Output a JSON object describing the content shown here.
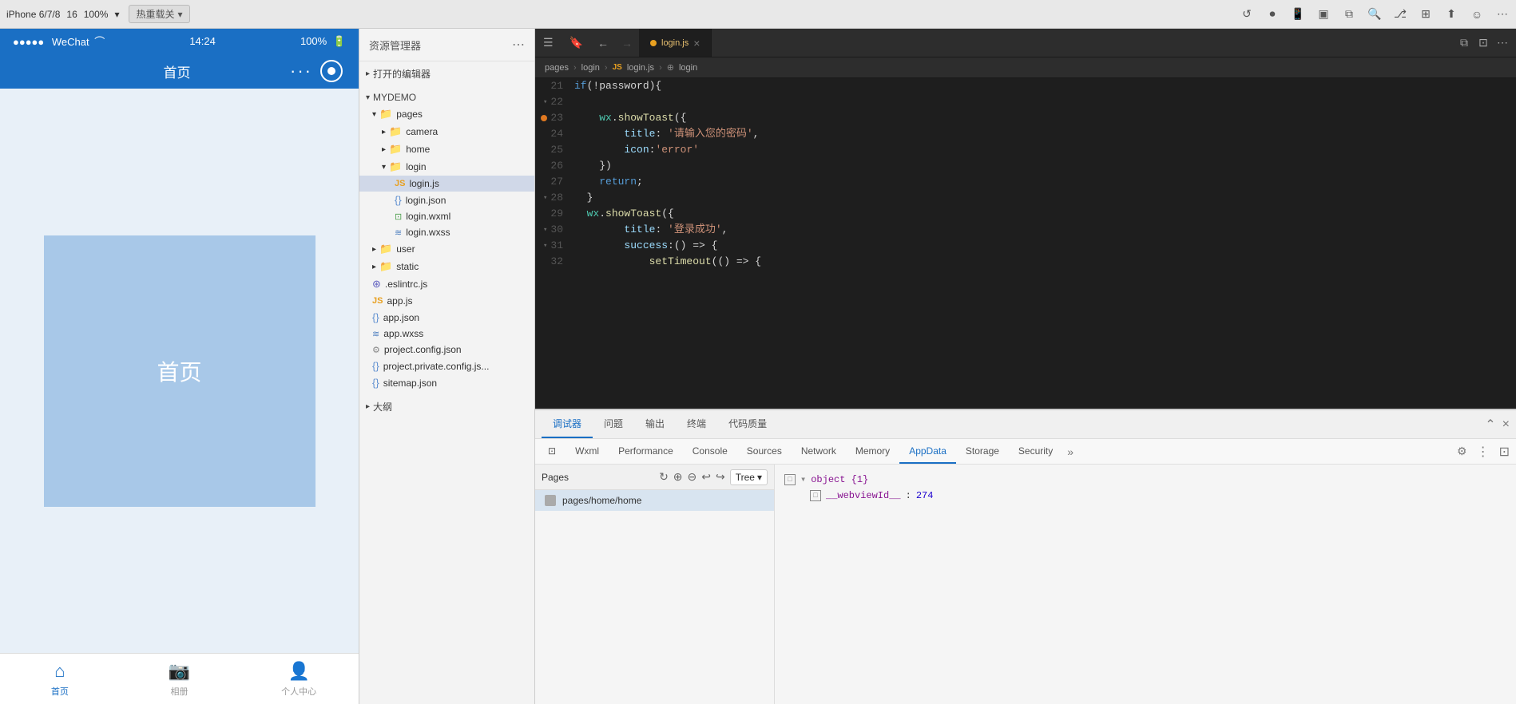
{
  "topToolbar": {
    "deviceLabel": "iPhone 6/7/8",
    "zoomLabel": "100%",
    "deviceNum": "16",
    "chevronIcon": "▾",
    "hotReloadLabel": "热重载关",
    "chevronIcon2": "▾"
  },
  "phone": {
    "statusBar": {
      "signals": "●●●●●",
      "appName": "WeChat",
      "wifiIcon": "WiFi",
      "time": "14:24",
      "battery": "100%"
    },
    "navTitle": "首页",
    "contentLabel": "首页",
    "tabs": [
      {
        "id": "home",
        "label": "首页",
        "icon": "⌂",
        "active": true
      },
      {
        "id": "camera",
        "label": "相册",
        "icon": "📷",
        "active": false
      },
      {
        "id": "profile",
        "label": "个人中心",
        "icon": "👤",
        "active": false
      }
    ]
  },
  "filePanel": {
    "title": "资源管理器",
    "sections": {
      "openEditors": "打开的编辑器",
      "myDemo": "MYDEMO"
    },
    "tree": [
      {
        "id": "pages",
        "type": "folder",
        "name": "pages",
        "indent": 1,
        "open": true
      },
      {
        "id": "camera",
        "type": "folder",
        "name": "camera",
        "indent": 2,
        "open": false
      },
      {
        "id": "home",
        "type": "folder",
        "name": "home",
        "indent": 2,
        "open": false
      },
      {
        "id": "login",
        "type": "folder",
        "name": "login",
        "indent": 2,
        "open": true
      },
      {
        "id": "loginjs",
        "type": "js",
        "name": "login.js",
        "indent": 3,
        "selected": true
      },
      {
        "id": "loginjson",
        "type": "json",
        "name": "login.json",
        "indent": 3
      },
      {
        "id": "loginwxml",
        "type": "wxml",
        "name": "login.wxml",
        "indent": 3
      },
      {
        "id": "loginwxss",
        "type": "wxss",
        "name": "login.wxss",
        "indent": 3
      },
      {
        "id": "user",
        "type": "folder",
        "name": "user",
        "indent": 1,
        "open": false
      },
      {
        "id": "static",
        "type": "folder",
        "name": "static",
        "indent": 1,
        "open": false
      },
      {
        "id": "eslintrc",
        "type": "eslint",
        "name": ".eslintrc.js",
        "indent": 1
      },
      {
        "id": "appjs",
        "type": "js",
        "name": "app.js",
        "indent": 1
      },
      {
        "id": "appjson",
        "type": "json",
        "name": "app.json",
        "indent": 1
      },
      {
        "id": "appwxss",
        "type": "wxss",
        "name": "app.wxss",
        "indent": 1
      },
      {
        "id": "projectconfig",
        "type": "config",
        "name": "project.config.json",
        "indent": 1
      },
      {
        "id": "projectprivate",
        "type": "json",
        "name": "project.private.config.js...",
        "indent": 1
      },
      {
        "id": "sitemap",
        "type": "json",
        "name": "sitemap.json",
        "indent": 1
      }
    ],
    "outlineLabel": "大纲"
  },
  "editor": {
    "tab": {
      "icon": "JS",
      "filename": "login.js",
      "hasChanges": true
    },
    "breadcrumb": {
      "parts": [
        "pages",
        "login",
        "login.js",
        "login"
      ]
    },
    "lines": [
      {
        "num": 21,
        "hasFold": false,
        "hasError": false,
        "content": "if(!password){",
        "tokens": [
          {
            "t": "kw",
            "v": "if"
          },
          {
            "t": "punct",
            "v": "(!password){"
          }
        ]
      },
      {
        "num": 22,
        "hasFold": true,
        "hasError": false,
        "content": "",
        "tokens": []
      },
      {
        "num": 23,
        "hasFold": false,
        "hasError": true,
        "content": "    wx.showToast({",
        "tokens": [
          {
            "t": "plain",
            "v": "    "
          },
          {
            "t": "obj",
            "v": "wx"
          },
          {
            "t": "punct",
            "v": "."
          },
          {
            "t": "fn",
            "v": "showToast"
          },
          {
            "t": "punct",
            "v": "({"
          }
        ]
      },
      {
        "num": 24,
        "hasFold": false,
        "hasError": false,
        "content": "        title: '请输入您的密码',",
        "tokens": [
          {
            "t": "plain",
            "v": "        "
          },
          {
            "t": "prop",
            "v": "title"
          },
          {
            "t": "punct",
            "v": ": "
          },
          {
            "t": "str",
            "v": "'请输入您的密码'"
          },
          {
            "t": "punct",
            "v": ","
          }
        ]
      },
      {
        "num": 25,
        "hasFold": false,
        "hasError": false,
        "content": "        icon:'error'",
        "tokens": [
          {
            "t": "plain",
            "v": "        "
          },
          {
            "t": "prop",
            "v": "icon"
          },
          {
            "t": "punct",
            "v": ":"
          },
          {
            "t": "str",
            "v": "'error'"
          }
        ]
      },
      {
        "num": 26,
        "hasFold": false,
        "hasError": false,
        "content": "    })",
        "tokens": [
          {
            "t": "plain",
            "v": "    "
          },
          {
            "t": "punct",
            "v": "})"
          }
        ]
      },
      {
        "num": 27,
        "hasFold": false,
        "hasError": false,
        "content": "    return;",
        "tokens": [
          {
            "t": "plain",
            "v": "    "
          },
          {
            "t": "kw",
            "v": "return"
          },
          {
            "t": "punct",
            "v": ";"
          }
        ]
      },
      {
        "num": 28,
        "hasFold": true,
        "hasError": false,
        "content": "  }",
        "tokens": [
          {
            "t": "plain",
            "v": "  "
          },
          {
            "t": "punct",
            "v": "}"
          }
        ]
      },
      {
        "num": 29,
        "hasFold": false,
        "hasError": false,
        "content": "  wx.showToast({",
        "tokens": [
          {
            "t": "plain",
            "v": "  "
          },
          {
            "t": "obj",
            "v": "wx"
          },
          {
            "t": "punct",
            "v": "."
          },
          {
            "t": "fn",
            "v": "showToast"
          },
          {
            "t": "punct",
            "v": "({"
          }
        ]
      },
      {
        "num": 30,
        "hasFold": false,
        "hasError": false,
        "content": "        title: '登录成功',",
        "tokens": [
          {
            "t": "plain",
            "v": "        "
          },
          {
            "t": "prop",
            "v": "title"
          },
          {
            "t": "punct",
            "v": ": "
          },
          {
            "t": "str",
            "v": "'登录成功'"
          },
          {
            "t": "punct",
            "v": ","
          }
        ]
      },
      {
        "num": 31,
        "hasFold": true,
        "hasError": false,
        "content": "        success:() => {",
        "tokens": [
          {
            "t": "plain",
            "v": "        "
          },
          {
            "t": "prop",
            "v": "success"
          },
          {
            "t": "punct",
            "v": ":"
          },
          {
            "t": "punct",
            "v": "() => {"
          }
        ]
      },
      {
        "num": 32,
        "hasFold": false,
        "hasError": false,
        "content": "            setTimeout(() => {",
        "tokens": [
          {
            "t": "plain",
            "v": "            "
          },
          {
            "t": "fn",
            "v": "setTimeout"
          },
          {
            "t": "punct",
            "v": "(() => {"
          }
        ]
      }
    ]
  },
  "devtools": {
    "mainTabs": [
      {
        "id": "debugger",
        "label": "调试器",
        "active": true
      },
      {
        "id": "problems",
        "label": "问题",
        "active": false
      },
      {
        "id": "output",
        "label": "输出",
        "active": false
      },
      {
        "id": "terminal",
        "label": "终端",
        "active": false
      },
      {
        "id": "codequality",
        "label": "代码质量",
        "active": false
      }
    ],
    "subTabs": [
      {
        "id": "wxml",
        "label": "Wxml",
        "active": false
      },
      {
        "id": "performance",
        "label": "Performance",
        "active": false
      },
      {
        "id": "console",
        "label": "Console",
        "active": false
      },
      {
        "id": "sources",
        "label": "Sources",
        "active": false
      },
      {
        "id": "network",
        "label": "Network",
        "active": false
      },
      {
        "id": "memory",
        "label": "Memory",
        "active": false
      },
      {
        "id": "appdata",
        "label": "AppData",
        "active": true
      },
      {
        "id": "storage",
        "label": "Storage",
        "active": false
      },
      {
        "id": "security",
        "label": "Security",
        "active": false
      }
    ],
    "leftPanel": {
      "label": "Pages",
      "toolbar": {
        "refreshLabel": "↻",
        "expandLabel": "⊕",
        "collapseLabel": "⊖",
        "undoLabel": "↩",
        "redoLabel": "↪"
      },
      "dropdown": "Tree",
      "items": [
        {
          "id": "home-page",
          "path": "pages/home/home",
          "selected": true
        }
      ]
    },
    "rightPanel": {
      "tree": [
        {
          "id": "obj-root",
          "indent": 0,
          "expandIcon": "▼",
          "boxIcon": "□",
          "key": "▾ object {1}",
          "value": ""
        },
        {
          "id": "webviewId",
          "indent": 1,
          "expandIcon": "",
          "boxIcon": "□",
          "key": "__webviewId__",
          "colon": " : ",
          "value": "274"
        }
      ]
    }
  }
}
